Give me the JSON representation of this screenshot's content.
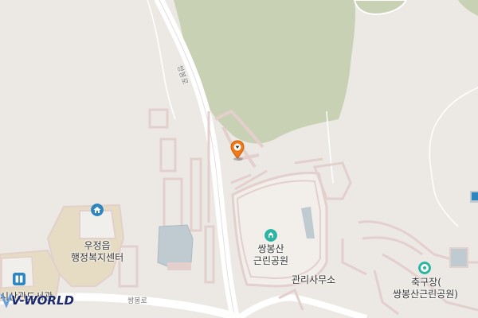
{
  "map": {
    "labels": {
      "ssangbong_road_vertical": "쌍봉로",
      "ssangbong_road_bottom": "쌍봉로",
      "park_line1": "쌍봉산",
      "park_line2": "근린공원",
      "office": "관리사무소",
      "welfare_line1": "우정읍",
      "welfare_line2": "행정복지센터",
      "football_line1": "축구장(",
      "football_line2": "쌍봉산근린공원)",
      "partial_left": "시산관도서관"
    },
    "icons": {
      "marker": "location-pin-icon",
      "park": "park-icon",
      "welfare": "government-office-icon",
      "football": "football-icon",
      "library": "library-icon"
    },
    "colors": {
      "background": "#ece9e4",
      "forest": "#c9d1b4",
      "road": "#ffffff",
      "building_outline": "#e3cfcc",
      "pool": "#bfcbd1",
      "sand": "#e6dcc4",
      "marker": "#f07a1a",
      "poi_blue": "#2e86c1",
      "poi_green": "#2bb5a2"
    },
    "logo": "V-WORLD"
  }
}
